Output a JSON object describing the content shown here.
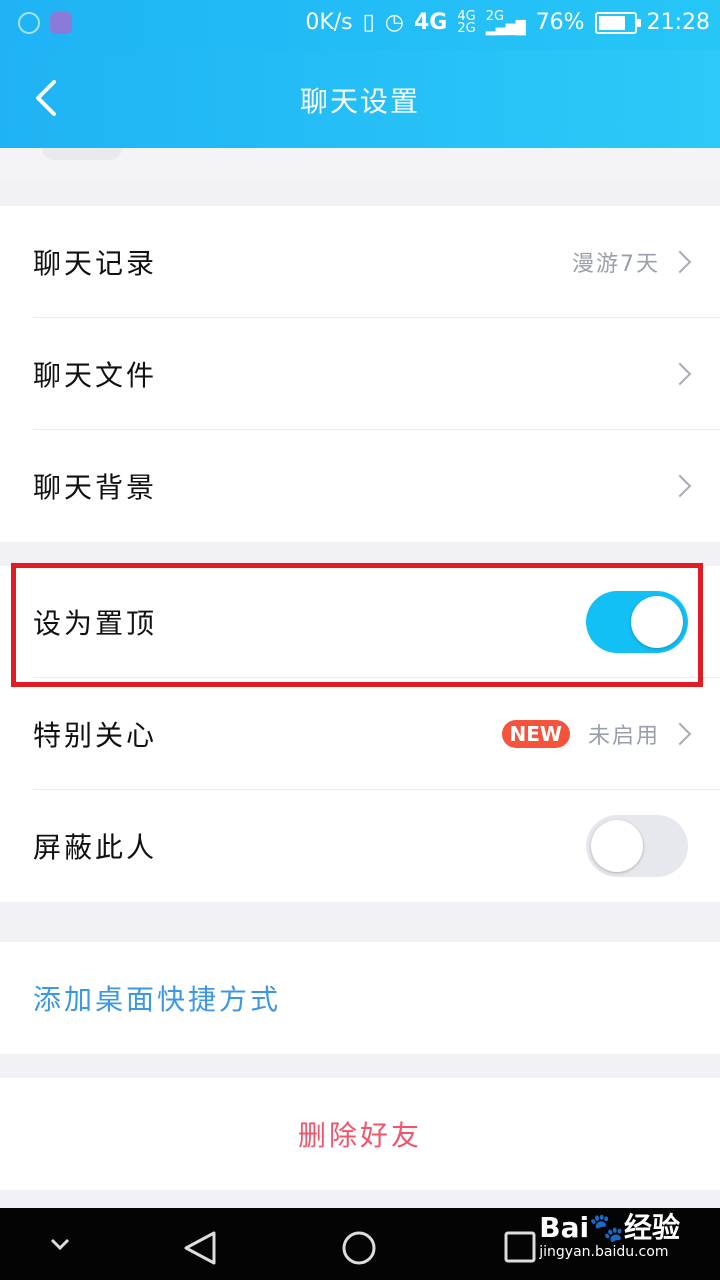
{
  "status_bar": {
    "speed": "0K/s",
    "net1": "4G",
    "net2": "4G",
    "net3": "2G",
    "net4": "2G",
    "battery_pct": "76%",
    "battery_level": 0.76,
    "time": "21:28"
  },
  "header": {
    "title": "聊天设置"
  },
  "section1": {
    "items": [
      {
        "label": "聊天记录",
        "value": "漫游7天"
      },
      {
        "label": "聊天文件"
      },
      {
        "label": "聊天背景"
      }
    ]
  },
  "section2": {
    "pin": {
      "label": "设为置顶",
      "enabled": true
    },
    "special": {
      "label": "特别关心",
      "badge": "NEW",
      "value": "未启用"
    },
    "block": {
      "label": "屏蔽此人",
      "enabled": false
    }
  },
  "shortcut": {
    "label": "添加桌面快捷方式"
  },
  "delete": {
    "label": "删除好友"
  },
  "watermark": {
    "brand": "Bai",
    "brand2": "经验",
    "url": "jingyan.baidu.com"
  },
  "colors": {
    "accent": "#12c0f6",
    "link": "#3c98e6",
    "danger": "#f0556b",
    "highlight": "#e01d23"
  }
}
